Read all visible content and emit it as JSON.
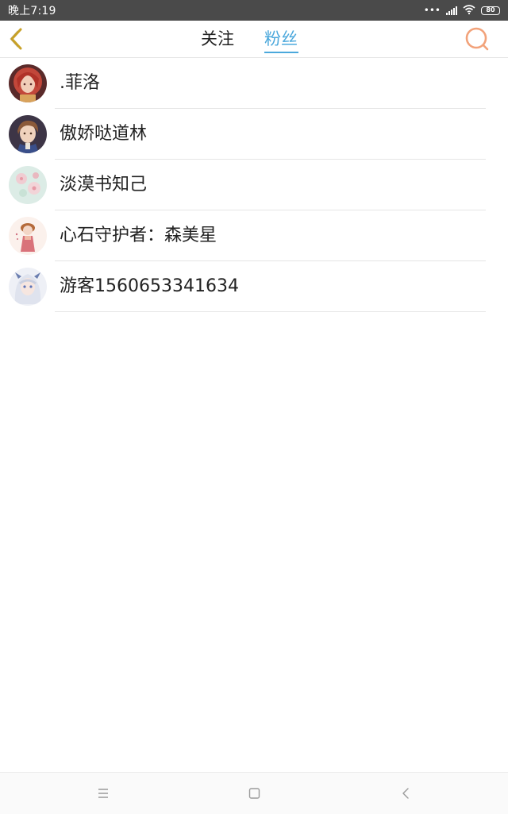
{
  "status_bar": {
    "time": "晚上7:19",
    "battery": "80"
  },
  "header": {
    "tabs": [
      {
        "label": "关注",
        "active": false
      },
      {
        "label": "粉丝",
        "active": true
      }
    ],
    "back_icon": "chevron-left-icon",
    "search_icon": "search-icon"
  },
  "colors": {
    "accent_blue": "#4ba8dc",
    "back_icon_gold": "#c9a227",
    "search_icon_orange": "#f2a27a",
    "status_bar_bg": "#4a4a4a"
  },
  "fans": [
    {
      "name": ".菲洛",
      "avatar": "avatar-red-hair-girl"
    },
    {
      "name": "傲娇哒道林",
      "avatar": "avatar-brown-hair-boy"
    },
    {
      "name": "淡漠书知己",
      "avatar": "avatar-floral-pattern"
    },
    {
      "name": "心石守护者：森美星",
      "avatar": "avatar-doll-figure"
    },
    {
      "name": "游客1560653341634",
      "avatar": "avatar-white-hair-character"
    }
  ],
  "nav_bar": {
    "icons": [
      "menu-icon",
      "home-square-icon",
      "back-triangle-icon"
    ]
  }
}
